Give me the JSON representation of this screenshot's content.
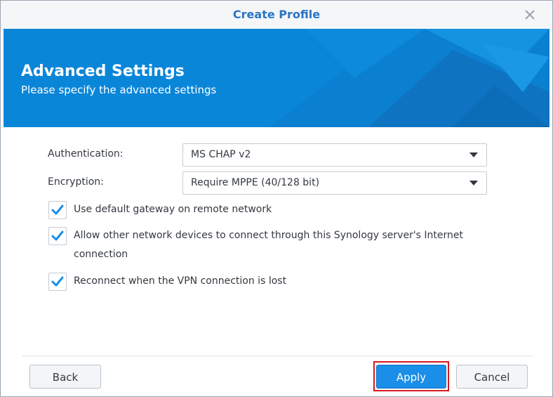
{
  "window": {
    "title": "Create Profile",
    "close_icon": "close-icon"
  },
  "banner": {
    "title": "Advanced Settings",
    "subtitle": "Please specify the advanced settings",
    "background_color": "#0a86d9"
  },
  "form": {
    "authentication": {
      "label": "Authentication:",
      "value": "MS CHAP v2"
    },
    "encryption": {
      "label": "Encryption:",
      "value": "Require MPPE (40/128 bit)"
    },
    "options": [
      {
        "label": "Use default gateway on remote network",
        "checked": true
      },
      {
        "label": "Allow other network devices to connect through this Synology server's Internet connection",
        "checked": true
      },
      {
        "label": "Reconnect when the VPN connection is lost",
        "checked": true
      }
    ]
  },
  "footer": {
    "back_label": "Back",
    "apply_label": "Apply",
    "cancel_label": "Cancel"
  },
  "colors": {
    "accent": "#2a75c4",
    "primary_button": "#1a8ee8",
    "highlight": "#d9161f"
  }
}
